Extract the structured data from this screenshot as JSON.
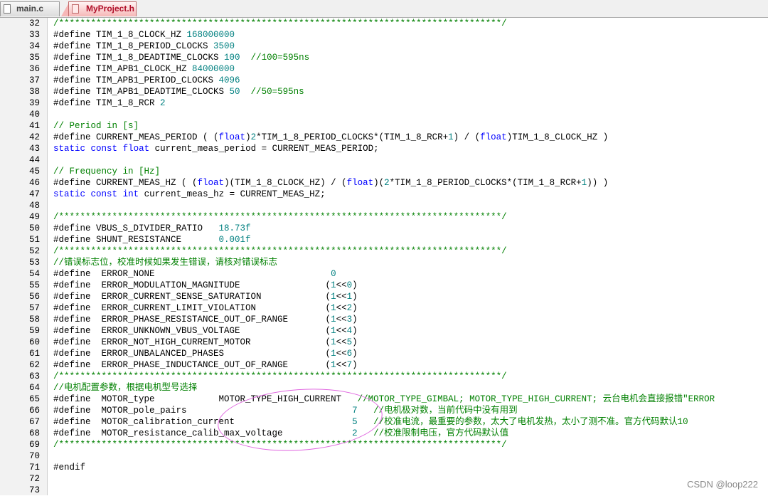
{
  "tabs": [
    {
      "label": "main.c",
      "active": false
    },
    {
      "label": "MyProject.h",
      "active": true
    }
  ],
  "editor": {
    "lines": [
      {
        "n": "32",
        "t": "/***********************************************************************************/",
        "c": "cm"
      },
      {
        "n": "33",
        "t": "#define TIM_1_8_CLOCK_HZ 168000000",
        "c": "def"
      },
      {
        "n": "34",
        "t": "#define TIM_1_8_PERIOD_CLOCKS 3500",
        "c": "def"
      },
      {
        "n": "35",
        "t": "#define TIM_1_8_DEADTIME_CLOCKS 100  //100=595ns",
        "c": "def"
      },
      {
        "n": "36",
        "t": "#define TIM_APB1_CLOCK_HZ 84000000",
        "c": "def"
      },
      {
        "n": "37",
        "t": "#define TIM_APB1_PERIOD_CLOCKS 4096",
        "c": "def"
      },
      {
        "n": "38",
        "t": "#define TIM_APB1_DEADTIME_CLOCKS 50  //50=595ns",
        "c": "def"
      },
      {
        "n": "39",
        "t": "#define TIM_1_8_RCR 2",
        "c": "def"
      },
      {
        "n": "40",
        "t": "",
        "c": "plain"
      },
      {
        "n": "41",
        "t": "// Period in [s]",
        "c": "cm"
      },
      {
        "n": "42",
        "t": "#define CURRENT_MEAS_PERIOD ( (float)2*TIM_1_8_PERIOD_CLOCKS*(TIM_1_8_RCR+1) / (float)TIM_1_8_CLOCK_HZ )",
        "c": "def"
      },
      {
        "n": "43",
        "t": "static const float current_meas_period = CURRENT_MEAS_PERIOD;",
        "c": "def"
      },
      {
        "n": "44",
        "t": "",
        "c": "plain"
      },
      {
        "n": "45",
        "t": "// Frequency in [Hz]",
        "c": "cm"
      },
      {
        "n": "46",
        "t": "#define CURRENT_MEAS_HZ ( (float)(TIM_1_8_CLOCK_HZ) / (float)(2*TIM_1_8_PERIOD_CLOCKS*(TIM_1_8_RCR+1)) )",
        "c": "def"
      },
      {
        "n": "47",
        "t": "static const int current_meas_hz = CURRENT_MEAS_HZ;",
        "c": "def"
      },
      {
        "n": "48",
        "t": "",
        "c": "plain"
      },
      {
        "n": "49",
        "t": "/***********************************************************************************/",
        "c": "cm"
      },
      {
        "n": "50",
        "t": "#define VBUS_S_DIVIDER_RATIO   18.73f",
        "c": "def"
      },
      {
        "n": "51",
        "t": "#define SHUNT_RESISTANCE       0.001f",
        "c": "def"
      },
      {
        "n": "52",
        "t": "/***********************************************************************************/",
        "c": "cm"
      },
      {
        "n": "53",
        "t": "//错误标志位，校准时候如果发生错误，请核对错误标志",
        "c": "cm"
      },
      {
        "n": "54",
        "t": "#define  ERROR_NONE                                 0",
        "c": "def"
      },
      {
        "n": "55",
        "t": "#define  ERROR_MODULATION_MAGNITUDE                (1<<0)",
        "c": "def"
      },
      {
        "n": "56",
        "t": "#define  ERROR_CURRENT_SENSE_SATURATION            (1<<1)",
        "c": "def"
      },
      {
        "n": "57",
        "t": "#define  ERROR_CURRENT_LIMIT_VIOLATION             (1<<2)",
        "c": "def"
      },
      {
        "n": "58",
        "t": "#define  ERROR_PHASE_RESISTANCE_OUT_OF_RANGE       (1<<3)",
        "c": "def"
      },
      {
        "n": "59",
        "t": "#define  ERROR_UNKNOWN_VBUS_VOLTAGE                (1<<4)",
        "c": "def"
      },
      {
        "n": "60",
        "t": "#define  ERROR_NOT_HIGH_CURRENT_MOTOR              (1<<5)",
        "c": "def"
      },
      {
        "n": "61",
        "t": "#define  ERROR_UNBALANCED_PHASES                   (1<<6)",
        "c": "def"
      },
      {
        "n": "62",
        "t": "#define  ERROR_PHASE_INDUCTANCE_OUT_OF_RANGE       (1<<7)",
        "c": "def"
      },
      {
        "n": "63",
        "t": "/***********************************************************************************/",
        "c": "cm"
      },
      {
        "n": "64",
        "t": "//电机配置参数，根据电机型号选择",
        "c": "cm"
      },
      {
        "n": "65",
        "t": "#define  MOTOR_type            MOTOR_TYPE_HIGH_CURRENT   //MOTOR_TYPE_GIMBAL; MOTOR_TYPE_HIGH_CURRENT; 云台电机会直接报错\"ERROR",
        "c": "def"
      },
      {
        "n": "66",
        "t": "#define  MOTOR_pole_pairs                               7   //电机极对数，当前代码中没有用到",
        "c": "def"
      },
      {
        "n": "67",
        "t": "#define  MOTOR_calibration_current                      5   //校准电流，最重要的参数，太大了电机发热，太小了测不准。官方代码默认10",
        "c": "def"
      },
      {
        "n": "68",
        "t": "#define  MOTOR_resistance_calib_max_voltage             2   //校准限制电压，官方代码默认值",
        "c": "def"
      },
      {
        "n": "69",
        "t": "/***********************************************************************************/",
        "c": "cm"
      },
      {
        "n": "70",
        "t": "",
        "c": "plain"
      },
      {
        "n": "71",
        "t": "#endif",
        "c": "def"
      },
      {
        "n": "72",
        "t": "",
        "c": "plain"
      },
      {
        "n": "73",
        "t": "",
        "c": "plain"
      }
    ]
  },
  "watermark": "CSDN @loop222",
  "colors": {
    "comment": "#008000",
    "keyword": "#0000ff",
    "number": "#008080",
    "active_tab_text": "#b0102a"
  }
}
